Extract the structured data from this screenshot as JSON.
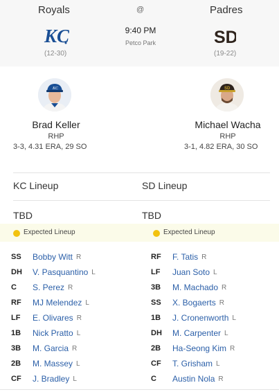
{
  "game": {
    "away_team": "Royals",
    "home_team": "Padres",
    "at_symbol": "@",
    "away_record": "(12-30)",
    "home_record": "(19-22)",
    "time": "9:40 PM",
    "venue": "Petco Park",
    "away_logo_text": "KC",
    "home_logo_text": "SD",
    "colors": {
      "royals_blue": "#1a4f95",
      "padres_brown": "#2f241d",
      "link_blue": "#2b5fa8",
      "expected_dot": "#f2c20f"
    }
  },
  "pitchers": {
    "away": {
      "name": "Brad Keller",
      "hand": "RHP",
      "stats": "3-3, 4.31 ERA, 29 SO"
    },
    "home": {
      "name": "Michael Wacha",
      "hand": "RHP",
      "stats": "3-1, 4.82 ERA, 30 SO"
    }
  },
  "lineups": {
    "away_heading": "KC Lineup",
    "home_heading": "SD Lineup",
    "away_status": "TBD",
    "home_status": "TBD",
    "expected_label_away": "Expected Lineup",
    "expected_label_home": "Expected Lineup",
    "away": [
      {
        "pos": "SS",
        "name": "Bobby Witt",
        "bats": "R"
      },
      {
        "pos": "DH",
        "name": "V. Pasquantino",
        "bats": "L"
      },
      {
        "pos": "C",
        "name": "S. Perez",
        "bats": "R"
      },
      {
        "pos": "RF",
        "name": "MJ Melendez",
        "bats": "L"
      },
      {
        "pos": "LF",
        "name": "E. Olivares",
        "bats": "R"
      },
      {
        "pos": "1B",
        "name": "Nick Pratto",
        "bats": "L"
      },
      {
        "pos": "3B",
        "name": "M. Garcia",
        "bats": "R"
      },
      {
        "pos": "2B",
        "name": "M. Massey",
        "bats": "L"
      },
      {
        "pos": "CF",
        "name": "J. Bradley",
        "bats": "L"
      }
    ],
    "home": [
      {
        "pos": "RF",
        "name": "F. Tatis",
        "bats": "R"
      },
      {
        "pos": "LF",
        "name": "Juan Soto",
        "bats": "L"
      },
      {
        "pos": "3B",
        "name": "M. Machado",
        "bats": "R"
      },
      {
        "pos": "SS",
        "name": "X. Bogaerts",
        "bats": "R"
      },
      {
        "pos": "1B",
        "name": "J. Cronenworth",
        "bats": "L"
      },
      {
        "pos": "DH",
        "name": "M. Carpenter",
        "bats": "L"
      },
      {
        "pos": "2B",
        "name": "Ha-Seong Kim",
        "bats": "R"
      },
      {
        "pos": "CF",
        "name": "T. Grisham",
        "bats": "L"
      },
      {
        "pos": "C",
        "name": "Austin Nola",
        "bats": "R"
      }
    ]
  }
}
